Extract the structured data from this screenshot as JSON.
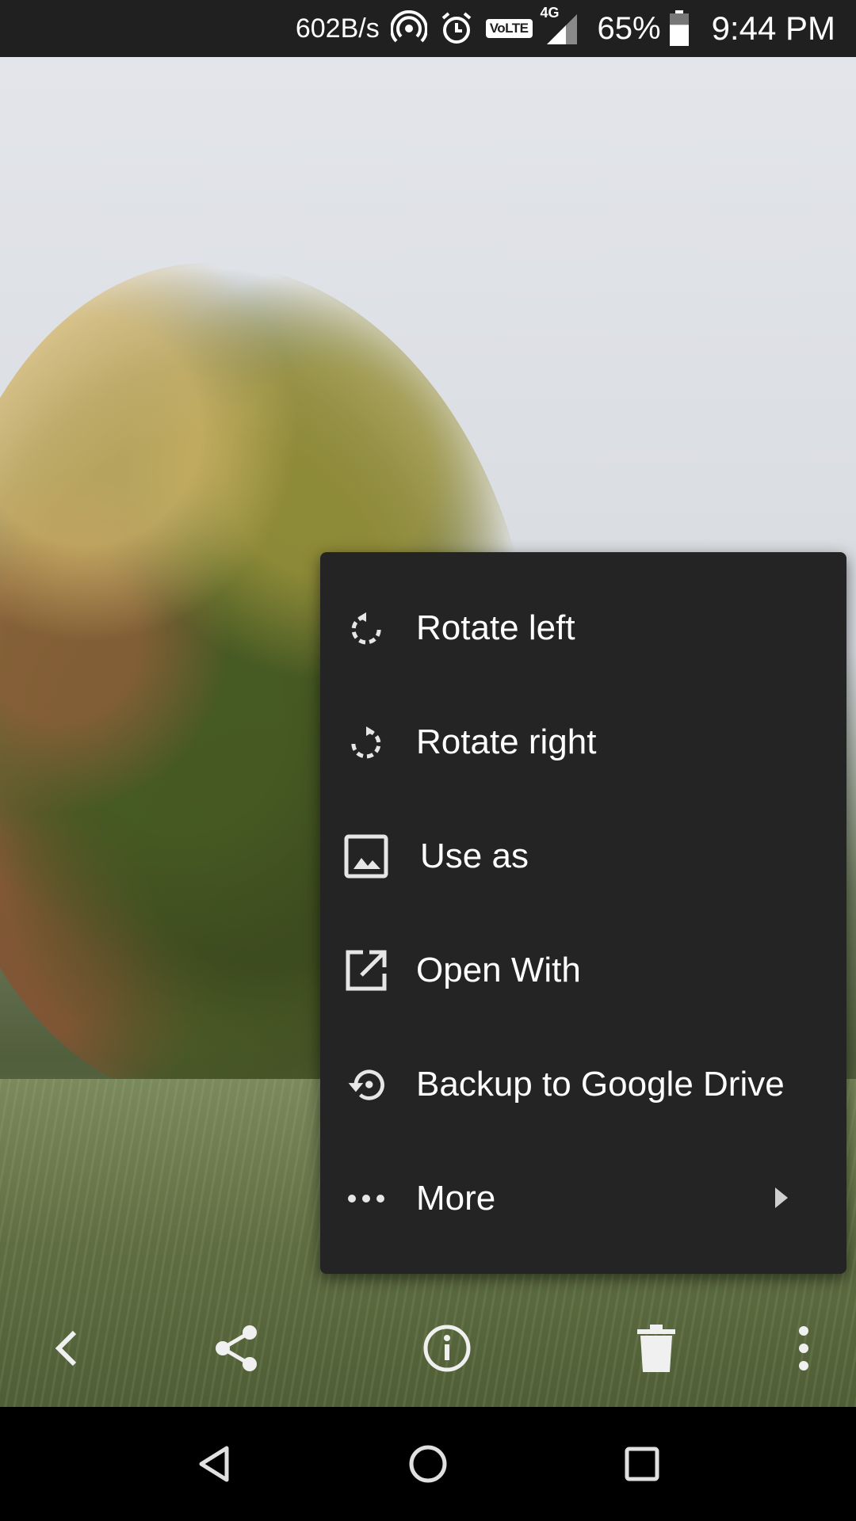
{
  "status_bar": {
    "net_speed": "602B/s",
    "volte_label": "VoLTE",
    "network_type": "4G",
    "battery_percent": "65%",
    "battery_level": 0.65,
    "time": "9:44 PM"
  },
  "photo": {
    "description_icon": "image"
  },
  "menu": {
    "items": [
      {
        "label": "Rotate left",
        "icon": "rotate-left-icon"
      },
      {
        "label": "Rotate right",
        "icon": "rotate-right-icon"
      },
      {
        "label": "Use as",
        "icon": "image-icon"
      },
      {
        "label": "Open With",
        "icon": "open-external-icon"
      },
      {
        "label": "Backup to Google Drive",
        "icon": "backup-icon"
      },
      {
        "label": "More",
        "icon": "more-horizontal-icon"
      }
    ]
  },
  "toolbar": {
    "buttons": [
      "back-icon",
      "share-icon",
      "info-icon",
      "delete-icon",
      "more-vertical-icon"
    ]
  },
  "colors": {
    "status_bar_bg": "#202020",
    "menu_bg": "#242424",
    "nav_bg": "#000000",
    "icon": "#e6e6e6"
  }
}
